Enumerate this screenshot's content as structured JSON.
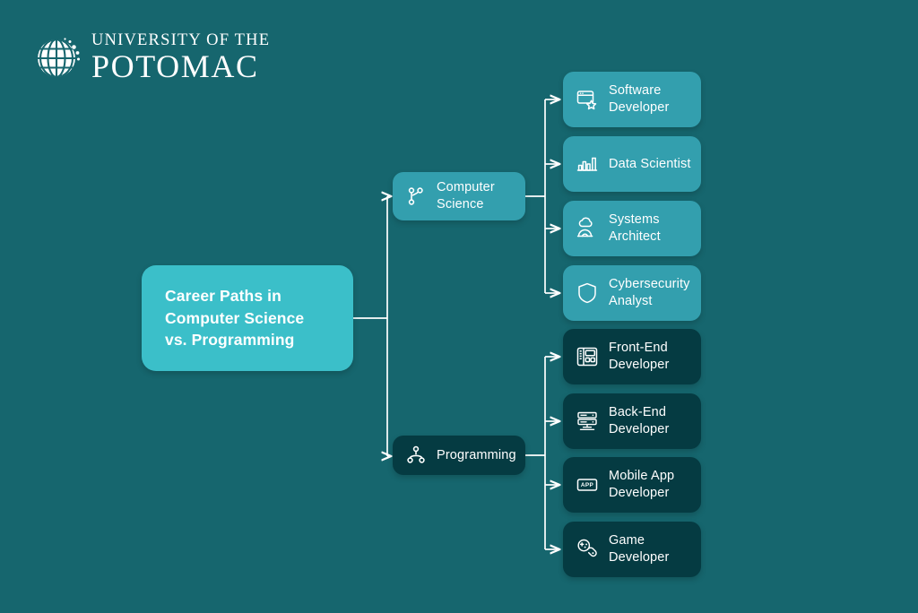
{
  "colors": {
    "background": "#16666e",
    "accent_turquoise": "#3bbfc9",
    "mid_teal": "#339fae",
    "dark_teal": "#053b42",
    "line": "#ffffff",
    "text": "#ffffff"
  },
  "logo": {
    "icon": "globe-icon",
    "line1": "UNIVERSITY OF THE",
    "line2": "POTOMAC"
  },
  "root": {
    "title": "Career Paths in Computer Science vs. Programming"
  },
  "branches": [
    {
      "id": "computer-science",
      "label": "Computer Science",
      "icon": "git-branch-icon",
      "style": "mid",
      "children": [
        {
          "label": "Software Developer",
          "icon": "browser-star-icon"
        },
        {
          "label": "Data Scientist",
          "icon": "bar-chart-icon"
        },
        {
          "label": "Systems Architect",
          "icon": "cloud-arch-icon"
        },
        {
          "label": "Cybersecurity Analyst",
          "icon": "shield-icon"
        }
      ]
    },
    {
      "id": "programming",
      "label": "Programming",
      "icon": "hierarchy-icon",
      "style": "dark",
      "children": [
        {
          "label": "Front-End Developer",
          "icon": "wireframe-layout-icon"
        },
        {
          "label": "Back-End Developer",
          "icon": "server-rack-icon"
        },
        {
          "label": "Mobile App Developer",
          "icon": "app-badge-icon"
        },
        {
          "label": "Game Developer",
          "icon": "gamepad-icon"
        }
      ]
    }
  ]
}
